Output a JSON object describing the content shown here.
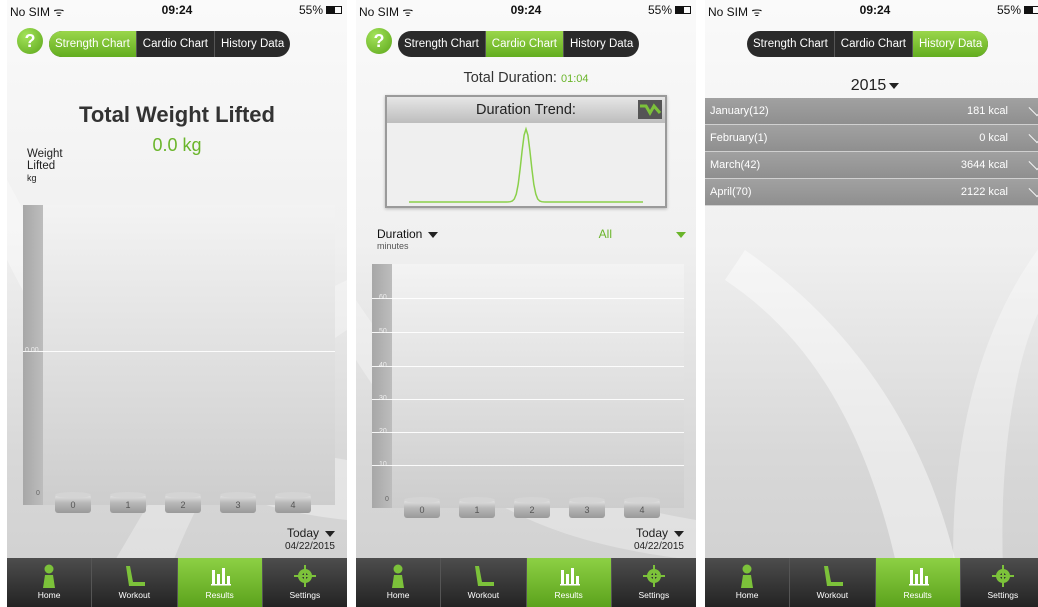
{
  "status_bar": {
    "carrier": "No SIM ᯤ",
    "time": "09:24",
    "battery": "55%"
  },
  "help_label": "?",
  "segments": {
    "strength": "Strength Chart",
    "cardio": "Cardio Chart",
    "history": "History Data"
  },
  "screen_strength": {
    "title": "Total Weight Lifted",
    "value": "0.0 kg",
    "y_label_line1": "Weight",
    "y_label_line2": "Lifted",
    "y_unit": "kg",
    "period": "Today",
    "date": "04/22/2015"
  },
  "screen_cardio": {
    "total_label": "Total Duration:",
    "total_value": "01:04",
    "trend_title": "Duration Trend:",
    "metric": "Duration",
    "metric_unit": "minutes",
    "filter": "All",
    "period": "Today",
    "date": "04/22/2015"
  },
  "screen_history": {
    "year": "2015",
    "rows": [
      {
        "month": "January(12)",
        "kcal": "181 kcal"
      },
      {
        "month": "February(1)",
        "kcal": "0 kcal"
      },
      {
        "month": "March(42)",
        "kcal": "3644 kcal"
      },
      {
        "month": "April(70)",
        "kcal": "2122 kcal"
      }
    ]
  },
  "chart_data": [
    {
      "type": "bar",
      "categories": [
        "0",
        "1",
        "2",
        "3",
        "4"
      ],
      "values": [
        0,
        0,
        0,
        0,
        0
      ],
      "y_ticks": [
        "0.00",
        "0"
      ],
      "xlabel": "",
      "ylabel": "Weight Lifted kg",
      "ylim": [
        0,
        1
      ]
    },
    {
      "type": "bar",
      "categories": [
        "0",
        "1",
        "2",
        "3",
        "4"
      ],
      "values": [
        0,
        0,
        0,
        0,
        0
      ],
      "y_ticks": [
        "60",
        "50",
        "40",
        "30",
        "20",
        "10",
        "0"
      ],
      "xlabel": "",
      "ylabel": "Duration minutes",
      "ylim": [
        0,
        60
      ]
    },
    {
      "type": "line",
      "title": "Duration Trend:",
      "x": [
        0,
        1,
        2,
        3,
        4,
        5,
        6,
        7,
        8,
        9,
        10
      ],
      "values": [
        0,
        0,
        0,
        0,
        0,
        64,
        0,
        0,
        0,
        0,
        0
      ]
    }
  ],
  "tabbar": {
    "home": "Home",
    "workout": "Workout",
    "results": "Results",
    "settings": "Settings"
  },
  "colors": {
    "accent": "#6ab52a",
    "tab_dark": "#2a2a2a",
    "list_row": "#999999"
  },
  "icons": {
    "help": "question-circle-icon",
    "home": "person-icon",
    "workout": "treadmill-icon",
    "results": "bar-chart-icon",
    "settings": "gear-icon",
    "trend": "trend-wave-icon"
  }
}
